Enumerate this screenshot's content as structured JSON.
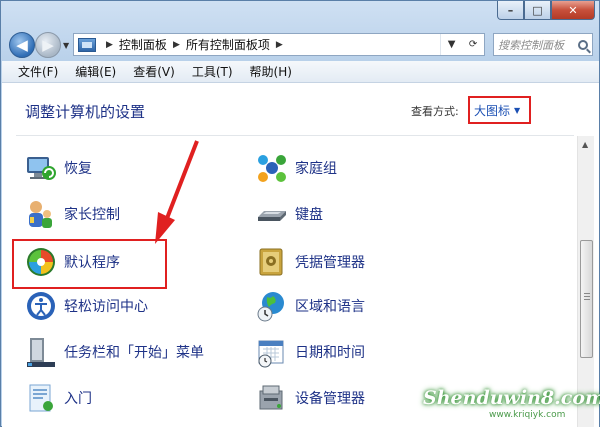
{
  "window": {
    "controls": {
      "minimize": "–",
      "maximize": "□",
      "close": "✕"
    }
  },
  "address": {
    "breadcrumbs": [
      "控制面板",
      "所有控制面板项"
    ],
    "back_icon": "back-arrow-icon",
    "forward_icon": "forward-arrow-icon"
  },
  "search": {
    "placeholder": "搜索控制面板"
  },
  "menu": {
    "items": [
      "文件(F)",
      "编辑(E)",
      "查看(V)",
      "工具(T)",
      "帮助(H)"
    ]
  },
  "content": {
    "title": "调整计算机的设置",
    "view_by_label": "查看方式:",
    "view_by_value": "大图标"
  },
  "items_left": [
    {
      "label": "恢复",
      "icon": "recovery-icon"
    },
    {
      "label": "家长控制",
      "icon": "parental-controls-icon"
    },
    {
      "label": "默认程序",
      "icon": "default-programs-icon"
    },
    {
      "label": "轻松访问中心",
      "icon": "ease-of-access-icon"
    },
    {
      "label": "任务栏和「开始」菜单",
      "icon": "taskbar-icon"
    },
    {
      "label": "入门",
      "icon": "getting-started-icon"
    }
  ],
  "items_right": [
    {
      "label": "家庭组",
      "icon": "homegroup-icon"
    },
    {
      "label": "键盘",
      "icon": "keyboard-icon"
    },
    {
      "label": "凭据管理器",
      "icon": "credential-manager-icon"
    },
    {
      "label": "区域和语言",
      "icon": "region-language-icon"
    },
    {
      "label": "日期和时间",
      "icon": "date-time-icon"
    },
    {
      "label": "设备管理器",
      "icon": "device-manager-icon"
    }
  ],
  "watermark": {
    "text": "Shenduwin8.com",
    "sub": "www.kriqiyk.com"
  },
  "colors": {
    "accent_red": "#e02020",
    "link_blue": "#1e3287"
  }
}
